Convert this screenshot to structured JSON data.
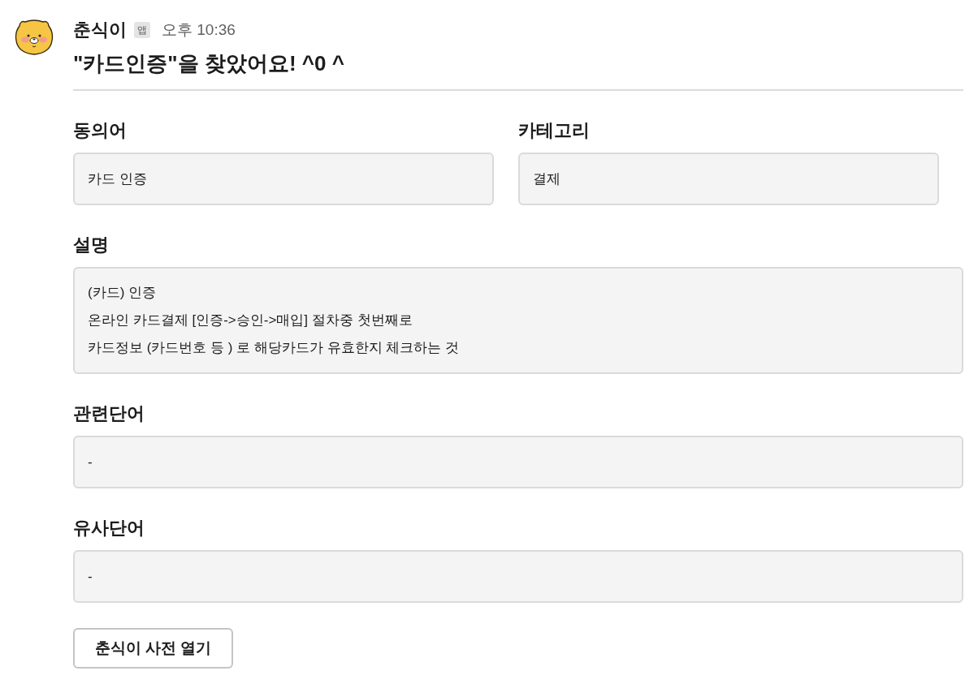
{
  "message": {
    "sender": "춘식이",
    "badge": "앱",
    "time": "오후 10:36",
    "title": "\"카드인증\"을 찾았어요! ^0 ^"
  },
  "fields": [
    {
      "kind": "half",
      "label": "동의어",
      "value": "카드 인증"
    },
    {
      "kind": "half",
      "label": "카테고리",
      "value": "결제"
    },
    {
      "kind": "full",
      "label": "설명",
      "value": "(카드) 인증\n온라인 카드결제 [인증->승인->매입] 절차중 첫번째로\n카드정보 (카드번호 등 ) 로 해당카드가 유효한지 체크하는 것"
    },
    {
      "kind": "full",
      "label": "관련단어",
      "value": "-"
    },
    {
      "kind": "full",
      "label": "유사단어",
      "value": "-"
    }
  ],
  "button": "춘식이 사전 열기"
}
